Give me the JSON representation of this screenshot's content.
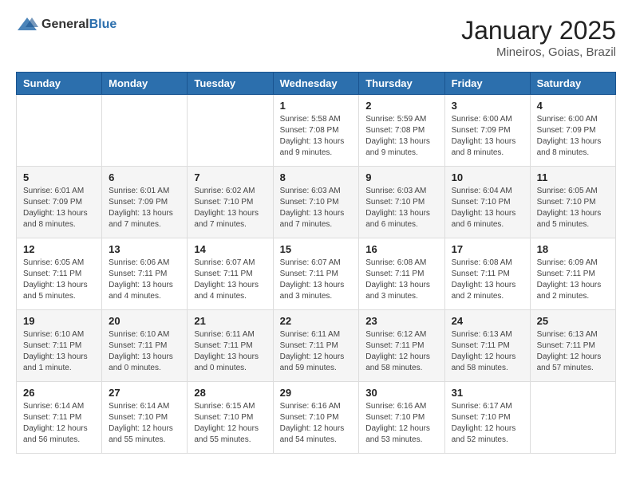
{
  "header": {
    "logo_general": "General",
    "logo_blue": "Blue",
    "title": "January 2025",
    "location": "Mineiros, Goias, Brazil"
  },
  "weekdays": [
    "Sunday",
    "Monday",
    "Tuesday",
    "Wednesday",
    "Thursday",
    "Friday",
    "Saturday"
  ],
  "weeks": [
    [
      {
        "day": "",
        "info": ""
      },
      {
        "day": "",
        "info": ""
      },
      {
        "day": "",
        "info": ""
      },
      {
        "day": "1",
        "info": "Sunrise: 5:58 AM\nSunset: 7:08 PM\nDaylight: 13 hours and 9 minutes."
      },
      {
        "day": "2",
        "info": "Sunrise: 5:59 AM\nSunset: 7:08 PM\nDaylight: 13 hours and 9 minutes."
      },
      {
        "day": "3",
        "info": "Sunrise: 6:00 AM\nSunset: 7:09 PM\nDaylight: 13 hours and 8 minutes."
      },
      {
        "day": "4",
        "info": "Sunrise: 6:00 AM\nSunset: 7:09 PM\nDaylight: 13 hours and 8 minutes."
      }
    ],
    [
      {
        "day": "5",
        "info": "Sunrise: 6:01 AM\nSunset: 7:09 PM\nDaylight: 13 hours and 8 minutes."
      },
      {
        "day": "6",
        "info": "Sunrise: 6:01 AM\nSunset: 7:09 PM\nDaylight: 13 hours and 7 minutes."
      },
      {
        "day": "7",
        "info": "Sunrise: 6:02 AM\nSunset: 7:10 PM\nDaylight: 13 hours and 7 minutes."
      },
      {
        "day": "8",
        "info": "Sunrise: 6:03 AM\nSunset: 7:10 PM\nDaylight: 13 hours and 7 minutes."
      },
      {
        "day": "9",
        "info": "Sunrise: 6:03 AM\nSunset: 7:10 PM\nDaylight: 13 hours and 6 minutes."
      },
      {
        "day": "10",
        "info": "Sunrise: 6:04 AM\nSunset: 7:10 PM\nDaylight: 13 hours and 6 minutes."
      },
      {
        "day": "11",
        "info": "Sunrise: 6:05 AM\nSunset: 7:10 PM\nDaylight: 13 hours and 5 minutes."
      }
    ],
    [
      {
        "day": "12",
        "info": "Sunrise: 6:05 AM\nSunset: 7:11 PM\nDaylight: 13 hours and 5 minutes."
      },
      {
        "day": "13",
        "info": "Sunrise: 6:06 AM\nSunset: 7:11 PM\nDaylight: 13 hours and 4 minutes."
      },
      {
        "day": "14",
        "info": "Sunrise: 6:07 AM\nSunset: 7:11 PM\nDaylight: 13 hours and 4 minutes."
      },
      {
        "day": "15",
        "info": "Sunrise: 6:07 AM\nSunset: 7:11 PM\nDaylight: 13 hours and 3 minutes."
      },
      {
        "day": "16",
        "info": "Sunrise: 6:08 AM\nSunset: 7:11 PM\nDaylight: 13 hours and 3 minutes."
      },
      {
        "day": "17",
        "info": "Sunrise: 6:08 AM\nSunset: 7:11 PM\nDaylight: 13 hours and 2 minutes."
      },
      {
        "day": "18",
        "info": "Sunrise: 6:09 AM\nSunset: 7:11 PM\nDaylight: 13 hours and 2 minutes."
      }
    ],
    [
      {
        "day": "19",
        "info": "Sunrise: 6:10 AM\nSunset: 7:11 PM\nDaylight: 13 hours and 1 minute."
      },
      {
        "day": "20",
        "info": "Sunrise: 6:10 AM\nSunset: 7:11 PM\nDaylight: 13 hours and 0 minutes."
      },
      {
        "day": "21",
        "info": "Sunrise: 6:11 AM\nSunset: 7:11 PM\nDaylight: 13 hours and 0 minutes."
      },
      {
        "day": "22",
        "info": "Sunrise: 6:11 AM\nSunset: 7:11 PM\nDaylight: 12 hours and 59 minutes."
      },
      {
        "day": "23",
        "info": "Sunrise: 6:12 AM\nSunset: 7:11 PM\nDaylight: 12 hours and 58 minutes."
      },
      {
        "day": "24",
        "info": "Sunrise: 6:13 AM\nSunset: 7:11 PM\nDaylight: 12 hours and 58 minutes."
      },
      {
        "day": "25",
        "info": "Sunrise: 6:13 AM\nSunset: 7:11 PM\nDaylight: 12 hours and 57 minutes."
      }
    ],
    [
      {
        "day": "26",
        "info": "Sunrise: 6:14 AM\nSunset: 7:11 PM\nDaylight: 12 hours and 56 minutes."
      },
      {
        "day": "27",
        "info": "Sunrise: 6:14 AM\nSunset: 7:10 PM\nDaylight: 12 hours and 55 minutes."
      },
      {
        "day": "28",
        "info": "Sunrise: 6:15 AM\nSunset: 7:10 PM\nDaylight: 12 hours and 55 minutes."
      },
      {
        "day": "29",
        "info": "Sunrise: 6:16 AM\nSunset: 7:10 PM\nDaylight: 12 hours and 54 minutes."
      },
      {
        "day": "30",
        "info": "Sunrise: 6:16 AM\nSunset: 7:10 PM\nDaylight: 12 hours and 53 minutes."
      },
      {
        "day": "31",
        "info": "Sunrise: 6:17 AM\nSunset: 7:10 PM\nDaylight: 12 hours and 52 minutes."
      },
      {
        "day": "",
        "info": ""
      }
    ]
  ]
}
